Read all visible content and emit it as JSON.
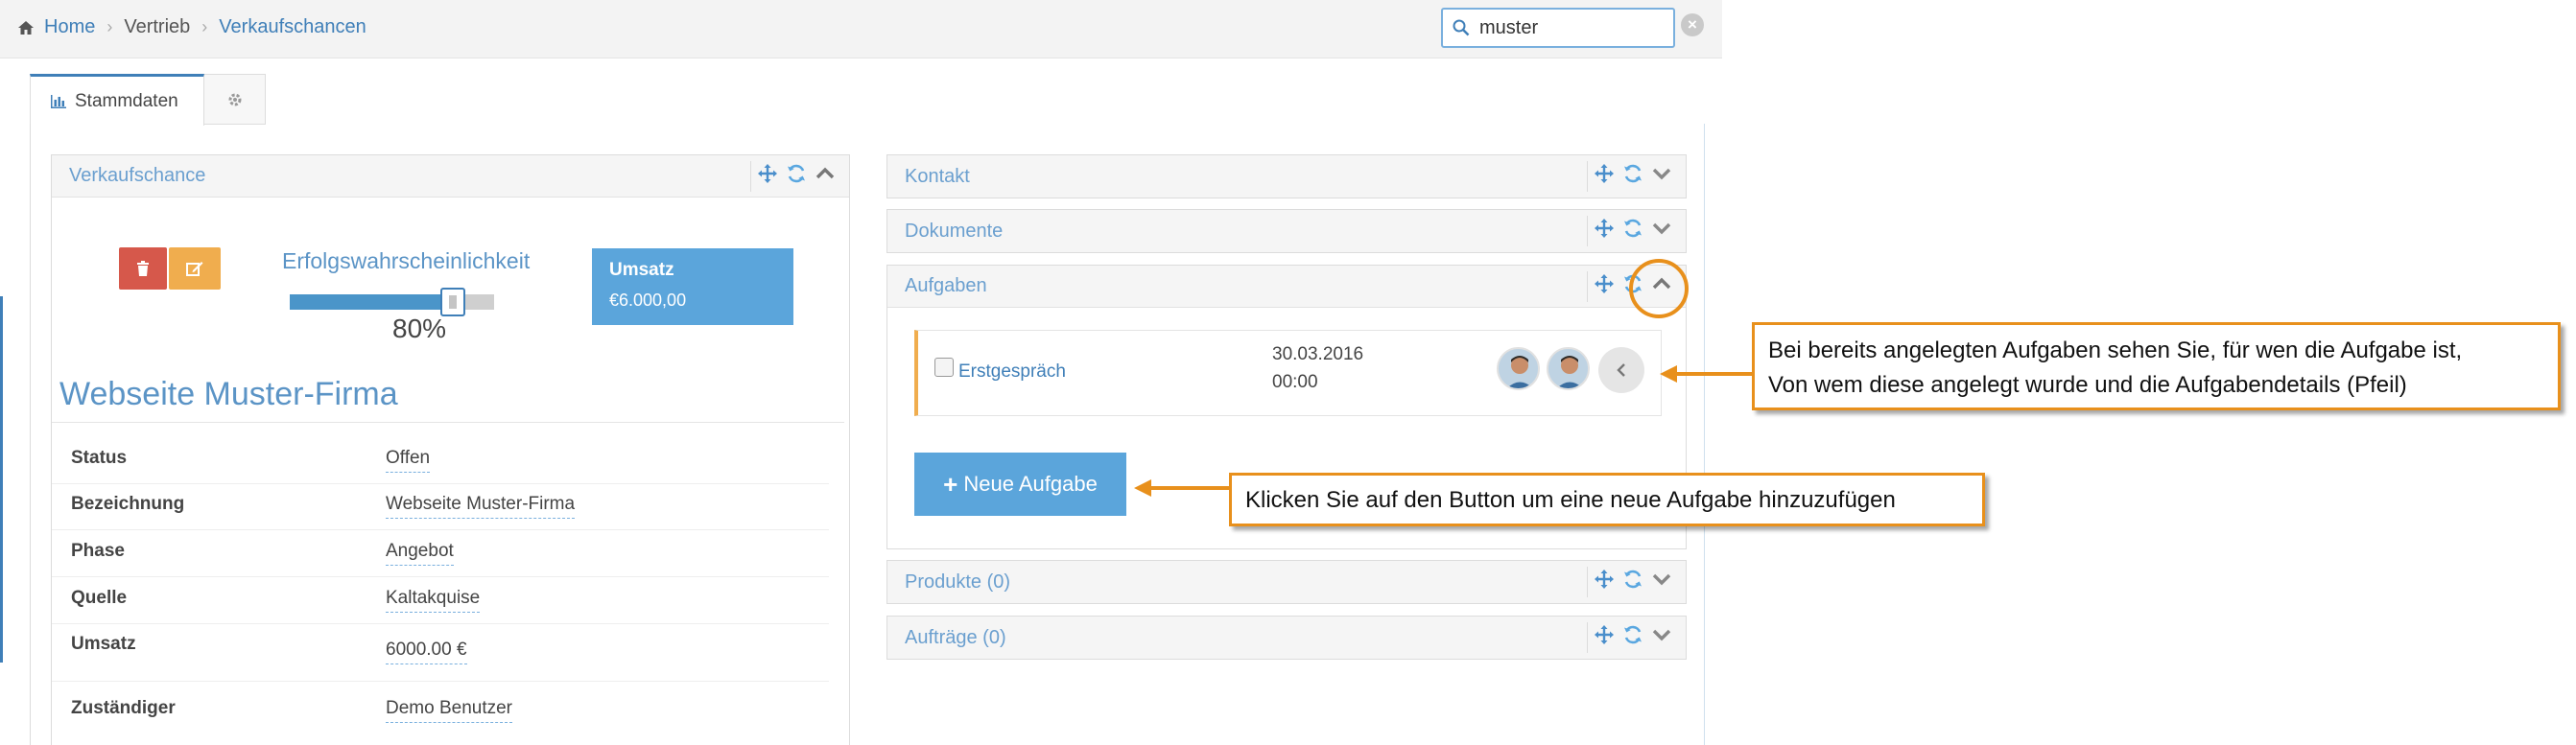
{
  "breadcrumb": {
    "home": "Home",
    "level2": "Vertrieb",
    "level3": "Verkaufschancen"
  },
  "search": {
    "value": "muster",
    "clear_label": "×"
  },
  "tabs": {
    "stammdaten": "Stammdaten"
  },
  "verkaufschance": {
    "title": "Verkaufschance",
    "probability_label": "Erfolgswahrscheinlichkeit",
    "probability": 0.8,
    "probability_text": "80%",
    "umsatz_title": "Umsatz",
    "umsatz_value": "€6.000,00",
    "name": "Webseite Muster-Firma",
    "fields": [
      {
        "label": "Status",
        "value": "Offen"
      },
      {
        "label": "Bezeichnung",
        "value": "Webseite Muster-Firma"
      },
      {
        "label": "Phase",
        "value": "Angebot"
      },
      {
        "label": "Quelle",
        "value": "Kaltakquise"
      },
      {
        "label": "Umsatz",
        "value": "6000.00 €"
      },
      {
        "label": "Zuständiger",
        "value": "Demo Benutzer"
      }
    ]
  },
  "panels": {
    "kontakt": "Kontakt",
    "dokumente": "Dokumente",
    "aufgaben": "Aufgaben",
    "produkte": "Produkte (0)",
    "auftraege": "Aufträge (0)"
  },
  "task": {
    "name": "Erstgespräch",
    "date": "30.03.2016",
    "time": "00:00"
  },
  "new_task_button": "Neue Aufgabe",
  "callouts": {
    "task_info_line1": "Bei bereits angelegten Aufgaben  sehen Sie, für wen die Aufgabe ist,",
    "task_info_line2": "Von wem diese angelegt wurde und die Aufgabendetails (Pfeil)",
    "new_task_info": "Klicken Sie auf den Button um eine neue Aufgabe hinzuzufügen"
  },
  "colors": {
    "accent_blue": "#3f7fb8",
    "button_blue": "#5ba5db",
    "delete_red": "#d6584b",
    "edit_orange": "#f0ad4e",
    "callout_orange": "#e8901c"
  },
  "icons": [
    "home-icon",
    "search-icon",
    "clear-icon",
    "bar-chart-icon",
    "gear-icon",
    "move-icon",
    "refresh-icon",
    "chevron-up-icon",
    "chevron-down-icon",
    "trash-icon",
    "edit-icon",
    "chevron-left-icon",
    "plus-icon"
  ]
}
